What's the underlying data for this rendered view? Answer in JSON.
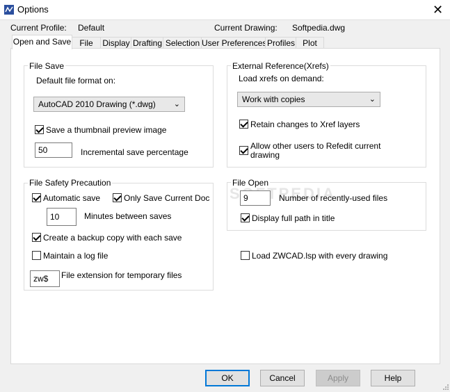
{
  "window": {
    "title": "Options",
    "close_glyph": "✕",
    "icon": "zwcad-app-icon"
  },
  "header": {
    "current_profile_label": "Current Profile:",
    "current_profile_value": "Default",
    "current_drawing_label": "Current Drawing:",
    "current_drawing_value": "Softpedia.dwg"
  },
  "tabs": [
    {
      "label": "Open and Save",
      "active": true
    },
    {
      "label": "File"
    },
    {
      "label": "Display"
    },
    {
      "label": "Drafting"
    },
    {
      "label": "Selection"
    },
    {
      "label": "User Preferences"
    },
    {
      "label": "Profiles"
    },
    {
      "label": "Plot"
    }
  ],
  "file_save": {
    "title": "File Save",
    "format_label": "Default file format on:",
    "format_value": "AutoCAD 2010 Drawing (*.dwg)",
    "thumbnail_label": "Save a thumbnail preview image",
    "thumbnail_checked": true,
    "incremental_value": "50",
    "incremental_label": "Incremental save percentage"
  },
  "file_safety": {
    "title": "File Safety Precaution",
    "autosave_label": "Automatic save",
    "autosave_checked": true,
    "only_current_label": "Only Save Current Doc",
    "only_current_checked": true,
    "minutes_value": "10",
    "minutes_label": "Minutes between saves",
    "backup_label": "Create a backup copy with each save",
    "backup_checked": true,
    "log_label": "Maintain a log file",
    "log_checked": false,
    "ext_value": "zw$",
    "ext_label": "File extension for temporary files"
  },
  "xrefs": {
    "title": "External Reference(Xrefs)",
    "load_label": "Load xrefs on demand:",
    "load_value": "Work with copies",
    "retain_label": "Retain changes to Xref layers",
    "retain_checked": true,
    "allow_label": "Allow other users to Refedit current drawing",
    "allow_checked": true
  },
  "file_open": {
    "title": "File Open",
    "recent_value": "9",
    "recent_label": "Number of recently-used files",
    "fullpath_label": "Display full path in title",
    "fullpath_checked": true
  },
  "load_lsp": {
    "label": "Load ZWCAD.lsp with every drawing",
    "checked": false
  },
  "watermark": "SOFTPEDIA",
  "buttons": {
    "ok": "OK",
    "cancel": "Cancel",
    "apply": "Apply",
    "help": "Help"
  },
  "colors": {
    "accent": "#0078d7",
    "app_icon": "#2b4f9e"
  }
}
